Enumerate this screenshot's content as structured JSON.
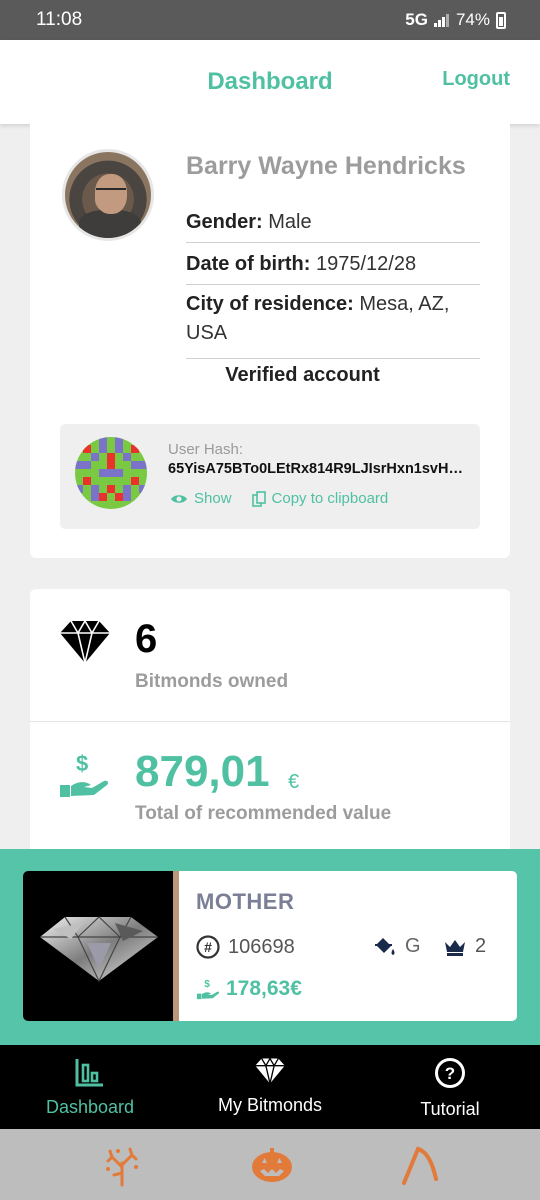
{
  "status_bar": {
    "time": "11:08",
    "network": "5G",
    "battery": "74%"
  },
  "header": {
    "title": "Dashboard",
    "logout_label": "Logout"
  },
  "profile": {
    "name": "Barry Wayne Hendricks",
    "gender_label": "Gender:",
    "gender_value": "Male",
    "dob_label": "Date of birth:",
    "dob_value": "1975/12/28",
    "city_label": "City of residence:",
    "city_value": "Mesa, AZ, USA",
    "verified": "Verified account",
    "hash_label": "User Hash:",
    "hash_value": "65YisA75BTo0LEtRx814R9LJIsrHxn1svH…",
    "show_label": "Show",
    "copy_label": "Copy to clipboard"
  },
  "stats": {
    "owned_count": "6",
    "owned_label": "Bitmonds owned",
    "total_value": "879,01",
    "currency": "€",
    "total_label": "Total of recommended value"
  },
  "featured": {
    "name": "MOTHER",
    "id": "106698",
    "color_grade": "G",
    "rank": "2",
    "price": "178,63€"
  },
  "nav": {
    "items": [
      {
        "label": "Dashboard",
        "icon": "chart-bars-icon",
        "active": true
      },
      {
        "label": "My Bitmonds",
        "icon": "diamond-icon",
        "active": false
      },
      {
        "label": "Tutorial",
        "icon": "help-circle-icon",
        "active": false
      }
    ]
  },
  "colors": {
    "accent": "#4fc1a2",
    "band": "#55c4a8",
    "nav_bg": "#000000"
  },
  "system_tray": {
    "icons": [
      "tree-icon",
      "pumpkin-icon",
      "scythe-icon"
    ]
  }
}
